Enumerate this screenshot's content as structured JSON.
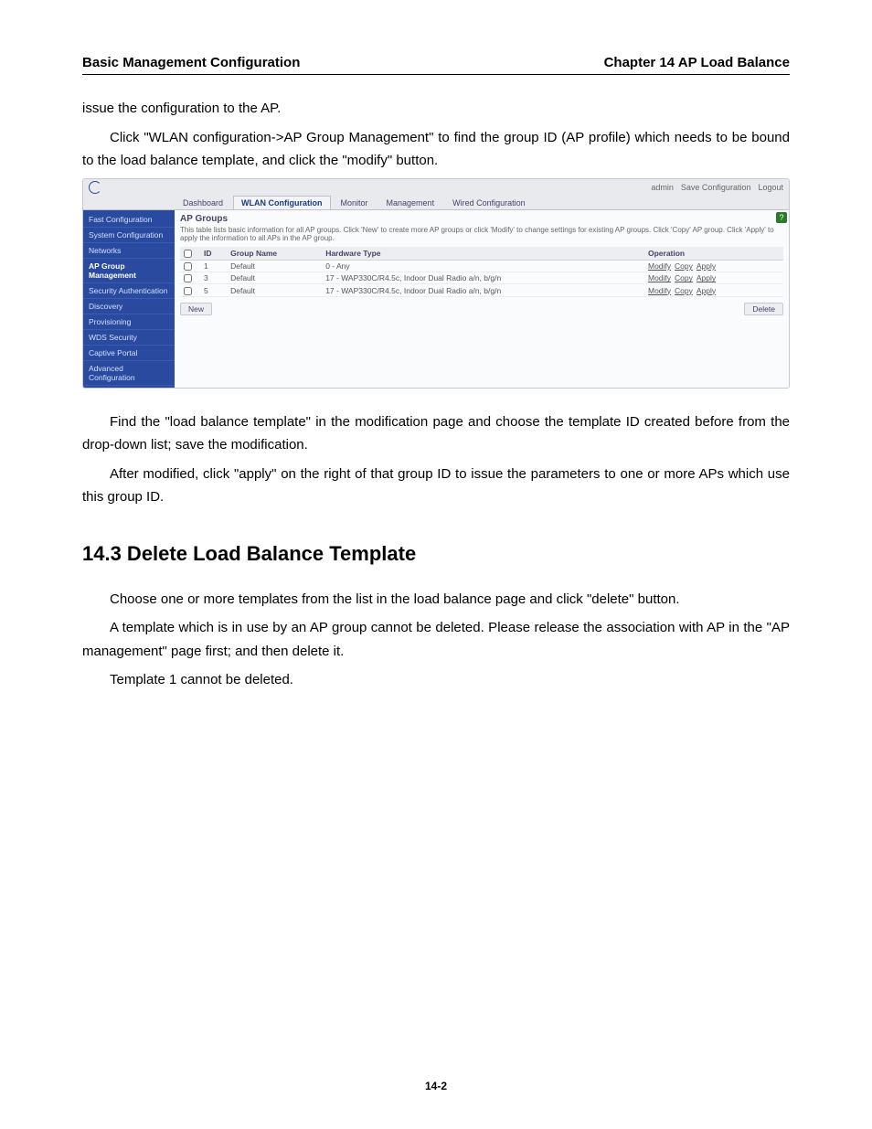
{
  "header": {
    "left": "Basic Management Configuration",
    "right": "Chapter 14 AP Load Balance"
  },
  "body": {
    "p1": "issue the configuration to the AP.",
    "p2": "Click \"WLAN configuration->AP Group Management\" to find the group ID (AP profile) which needs to be bound to the load balance template, and click the \"modify\" button.",
    "p3": "Find the \"load balance template\" in the modification page and choose the template ID created before from the drop-down list; save the modification.",
    "p4": "After modified, click \"apply\" on the right of that group ID to issue the parameters to one or more APs which use this group ID.",
    "section_title": "14.3 Delete Load Balance Template",
    "p5": "Choose one or more templates from the list in the load balance page and click \"delete\" button.",
    "p6": "A template which is in use by an AP group cannot be deleted. Please release the association with AP in the \"AP management\" page first; and then delete it.",
    "p7": "Template 1 cannot be deleted."
  },
  "footer": {
    "page": "14-2"
  },
  "screenshot": {
    "userbar": {
      "user": "admin",
      "save": "Save Configuration",
      "logout": "Logout"
    },
    "tabs": [
      "Dashboard",
      "WLAN Configuration",
      "Monitor",
      "Management",
      "Wired Configuration"
    ],
    "active_tab_index": 1,
    "sidebar": [
      "Fast Configuration",
      "System Configuration",
      "Networks",
      "AP Group Management",
      "Security Authentication",
      "Discovery",
      "Provisioning",
      "WDS Security",
      "Captive Portal",
      "Advanced Configuration"
    ],
    "active_side_index": 3,
    "panel": {
      "title": "AP Groups",
      "desc": "This table lists basic information for all AP groups. Click 'New' to create more AP groups or click 'Modify' to change settings for existing AP groups. Click 'Copy' AP group. Click 'Apply' to apply the information to all APs in the AP group.",
      "columns": [
        "",
        "ID",
        "Group Name",
        "Hardware Type",
        "Operation"
      ],
      "rows": [
        {
          "id": "1",
          "name": "Default",
          "hw": "0 - Any",
          "ops": [
            "Modify",
            "Copy",
            "Apply"
          ]
        },
        {
          "id": "3",
          "name": "Default",
          "hw": "17 - WAP330C/R4.5c, Indoor Dual Radio a/n, b/g/n",
          "ops": [
            "Modify",
            "Copy",
            "Apply"
          ]
        },
        {
          "id": "5",
          "name": "Default",
          "hw": "17 - WAP330C/R4.5c, Indoor Dual Radio a/n, b/g/n",
          "ops": [
            "Modify",
            "Copy",
            "Apply"
          ]
        }
      ],
      "buttons": {
        "new": "New",
        "delete": "Delete"
      },
      "help": "?"
    }
  }
}
